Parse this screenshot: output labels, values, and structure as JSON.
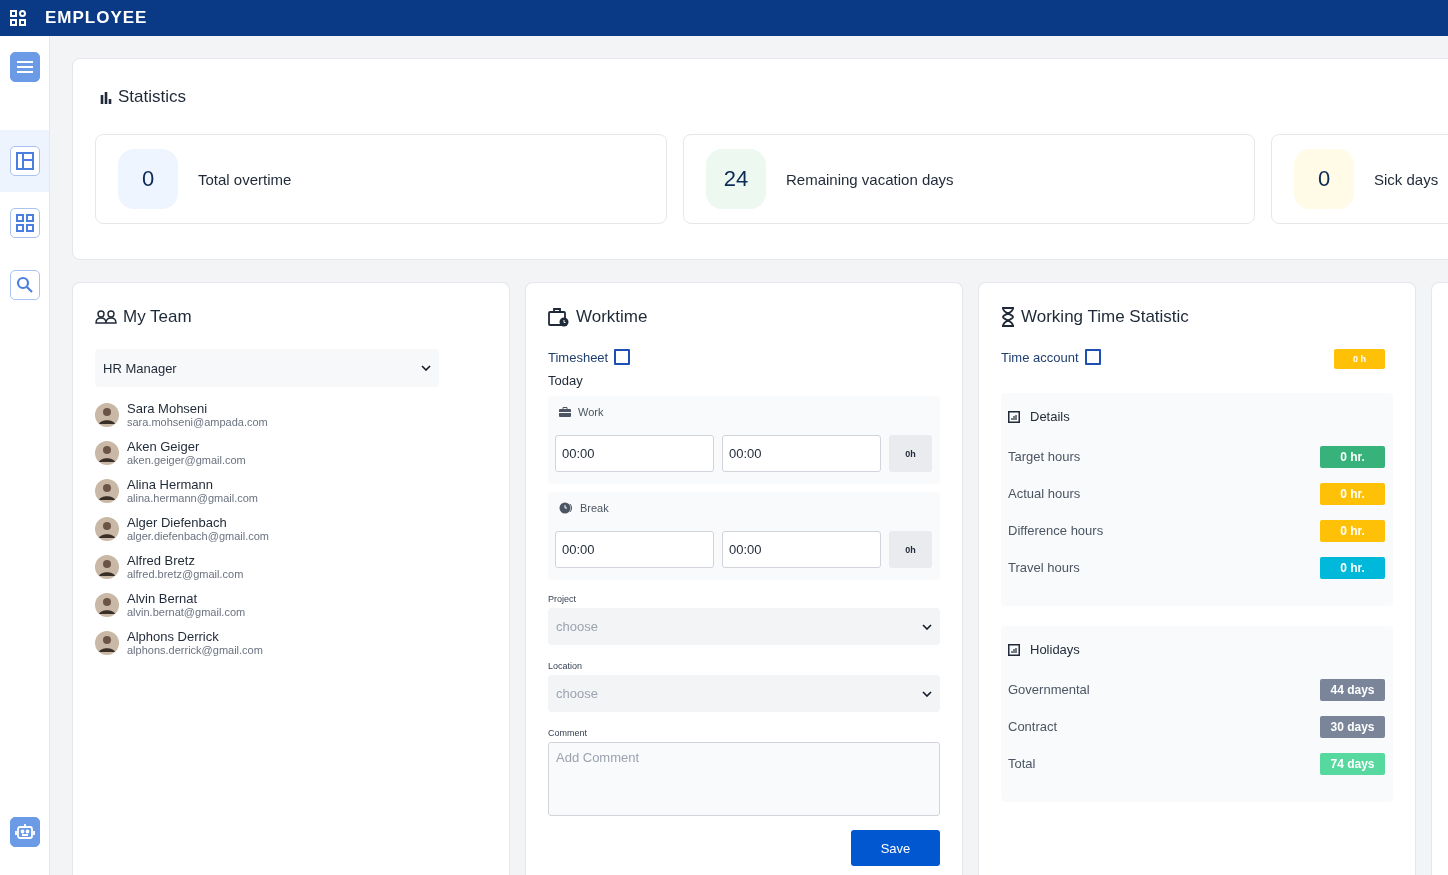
{
  "topbar": {
    "title": "EMPLOYEE"
  },
  "sidebar": {
    "items": [
      {
        "kind": "menu",
        "selected": false
      },
      {
        "kind": "layout",
        "selected": true
      },
      {
        "kind": "grid",
        "selected": false
      },
      {
        "kind": "search",
        "selected": false
      }
    ]
  },
  "statistics": {
    "title": "Statistics",
    "cards": [
      {
        "value": "0",
        "label": "Total overtime",
        "color": "#eef5ff"
      },
      {
        "value": "24",
        "label": "Remaining vacation days",
        "color": "#ecf8f0"
      },
      {
        "value": "0",
        "label": "Sick days",
        "color": "#fffbe6"
      }
    ]
  },
  "my_team": {
    "title": "My Team",
    "role_select": "HR Manager",
    "members": [
      {
        "name": "Sara Mohseni",
        "email": "sara.mohseni@ampada.com"
      },
      {
        "name": "Aken Geiger",
        "email": "aken.geiger@gmail.com"
      },
      {
        "name": "Alina Hermann",
        "email": "alina.hermann@gmail.com"
      },
      {
        "name": "Alger Diefenbach",
        "email": "alger.diefenbach@gmail.com"
      },
      {
        "name": "Alfred Bretz",
        "email": "alfred.bretz@gmail.com"
      },
      {
        "name": "Alvin Bernat",
        "email": "alvin.bernat@gmail.com"
      },
      {
        "name": "Alphons Derrick",
        "email": "alphons.derrick@gmail.com"
      }
    ]
  },
  "worktime": {
    "title": "Worktime",
    "timesheet_link": "Timesheet",
    "day": "Today",
    "blocks": [
      {
        "kind": "work",
        "label": "Work",
        "start": "00:00",
        "end": "00:00",
        "total": "0h"
      },
      {
        "kind": "break",
        "label": "Break",
        "start": "00:00",
        "end": "00:00",
        "total": "0h"
      }
    ],
    "project": {
      "label": "Project",
      "placeholder": "choose"
    },
    "location": {
      "label": "Location",
      "placeholder": "choose"
    },
    "comment": {
      "label": "Comment",
      "placeholder": "Add Comment"
    },
    "save_button": "Save"
  },
  "working_time_statistic": {
    "title": "Working Time Statistic",
    "time_account_link": "Time account",
    "time_account_value": "0 h",
    "details": {
      "title": "Details",
      "rows": [
        {
          "label": "Target hours",
          "value": "0 hr.",
          "color": "#38b27b"
        },
        {
          "label": "Actual hours",
          "value": "0 hr.",
          "color": "#ffc107"
        },
        {
          "label": "Difference hours",
          "value": "0 hr.",
          "color": "#ffc107"
        },
        {
          "label": "Travel hours",
          "value": "0 hr.",
          "color": "#00b8d9"
        }
      ]
    },
    "holidays": {
      "title": "Holidays",
      "rows": [
        {
          "label": "Governmental",
          "value": "44 days",
          "color": "#7a8599"
        },
        {
          "label": "Contract",
          "value": "30 days",
          "color": "#7a8599"
        },
        {
          "label": "Total",
          "value": "74 days",
          "color": "#56d89e"
        }
      ]
    }
  }
}
